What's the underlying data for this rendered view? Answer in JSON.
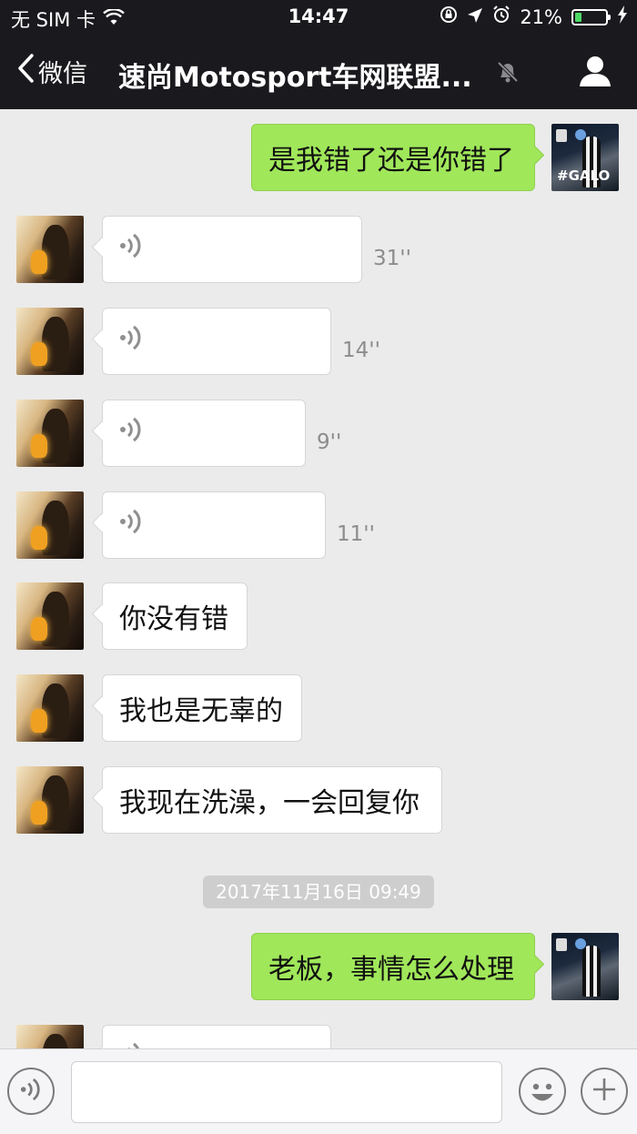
{
  "status_bar": {
    "carrier": "无 SIM 卡",
    "time": "14:47",
    "battery_percent": "21%",
    "battery_level": 0.21,
    "icons": [
      "wifi-icon",
      "orientation-lock-icon",
      "location-icon",
      "alarm-icon",
      "battery-icon",
      "charging-icon"
    ]
  },
  "nav": {
    "back_label": "微信",
    "title": "速尚Motosport车网联盟...",
    "icons": [
      "back-chevron-icon",
      "mute-bell-icon",
      "profile-icon"
    ]
  },
  "messages": [
    {
      "side": "out",
      "type": "text",
      "text": "是我错了还是你错了"
    },
    {
      "side": "in",
      "type": "voice",
      "duration": "31''"
    },
    {
      "side": "in",
      "type": "voice",
      "duration": "14''"
    },
    {
      "side": "in",
      "type": "voice",
      "duration": "9''"
    },
    {
      "side": "in",
      "type": "voice",
      "duration": "11''"
    },
    {
      "side": "in",
      "type": "text",
      "text": "你没有错"
    },
    {
      "side": "in",
      "type": "text",
      "text": "我也是无辜的"
    },
    {
      "side": "in",
      "type": "text",
      "text": "我现在洗澡，一会回复你"
    },
    {
      "type": "timestamp",
      "text": "2017年11月16日 09:49"
    },
    {
      "side": "out",
      "type": "text",
      "text": "老板，事情怎么处理"
    },
    {
      "side": "in",
      "type": "voice",
      "duration": ""
    }
  ],
  "right_avatar_text": "#GALO",
  "input_bar": {
    "value": "",
    "icons": [
      "voice-input-icon",
      "emoji-icon",
      "plus-icon"
    ]
  },
  "colors": {
    "nav_bg": "#1a1a1e",
    "chat_bg": "#ebebeb",
    "outgoing_bubble": "#a0e75a",
    "incoming_bubble": "#ffffff",
    "battery_fill": "#4cd964"
  }
}
